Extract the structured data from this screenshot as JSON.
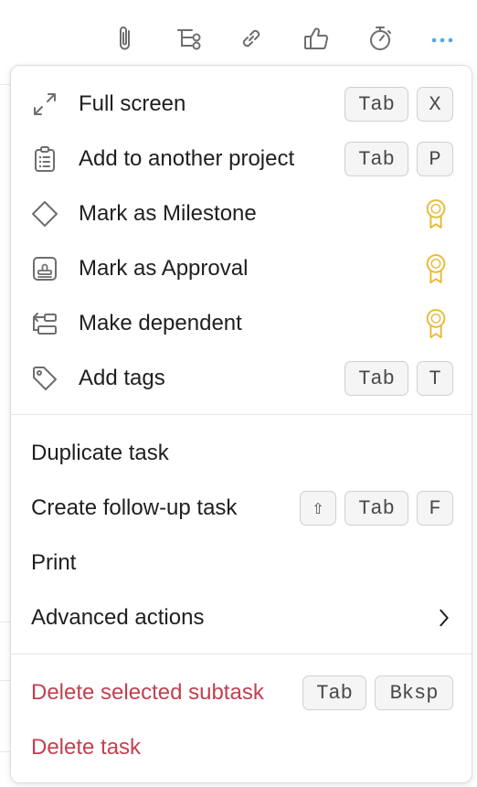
{
  "toolbar": {
    "icons": [
      "paperclip-icon",
      "subtask-icon",
      "link-icon",
      "thumbs-up-icon",
      "stopwatch-icon",
      "more-icon"
    ],
    "accent": "#4ea7e6"
  },
  "menu": {
    "section1": [
      {
        "label": "Full screen",
        "icon": "expand-icon",
        "keys": [
          "Tab",
          "X"
        ]
      },
      {
        "label": "Add to another project",
        "icon": "clipboard-list-icon",
        "keys": [
          "Tab",
          "P"
        ]
      },
      {
        "label": "Mark as Milestone",
        "icon": "diamond-icon",
        "badge": "premium-ribbon-icon"
      },
      {
        "label": "Mark as Approval",
        "icon": "stamp-icon",
        "badge": "premium-ribbon-icon"
      },
      {
        "label": "Make dependent",
        "icon": "dependency-icon",
        "badge": "premium-ribbon-icon"
      },
      {
        "label": "Add tags",
        "icon": "tag-icon",
        "keys": [
          "Tab",
          "T"
        ]
      }
    ],
    "section2": [
      {
        "label": "Duplicate task"
      },
      {
        "label": "Create follow-up task",
        "keys": [
          "⇧",
          "Tab",
          "F"
        ]
      },
      {
        "label": "Print"
      },
      {
        "label": "Advanced actions",
        "icon": "chevron-right-icon"
      }
    ],
    "section3": [
      {
        "label": "Delete selected subtask",
        "keys": [
          "Tab",
          "Bksp"
        ]
      },
      {
        "label": "Delete task"
      }
    ]
  },
  "colors": {
    "danger": "#c4404f",
    "premium": "#e8b82e",
    "icon": "#6d6e6f"
  }
}
